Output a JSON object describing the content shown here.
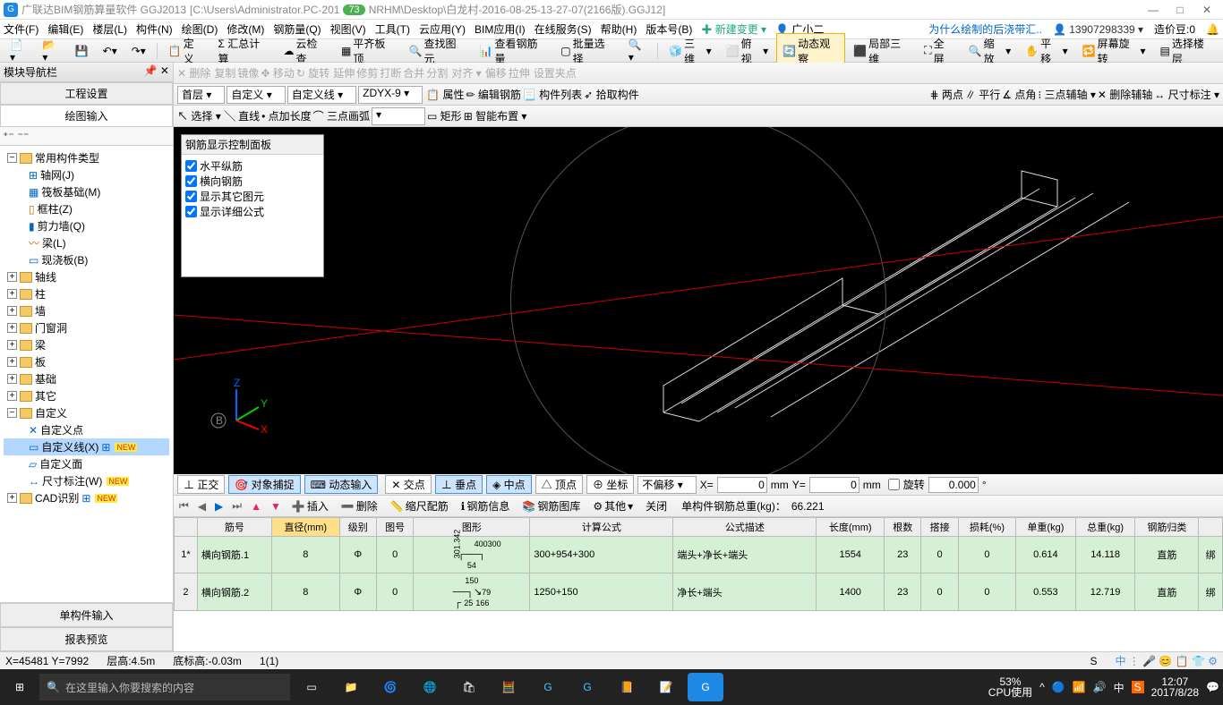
{
  "titlebar": {
    "app_name": "广联达BIM钢筋算量软件 GGJ2013",
    "file_path": "[C:\\Users\\Administrator.PC-201",
    "badge": "73",
    "file_rest": "NRHM\\Desktop\\白龙村-2016-08-25-13-27-07(2166版).GGJ12]"
  },
  "menubar": {
    "items": [
      "文件(F)",
      "编辑(E)",
      "楼层(L)",
      "构件(N)",
      "绘图(D)",
      "修改(M)",
      "钢筋量(Q)",
      "视图(V)",
      "工具(T)",
      "云应用(Y)",
      "BIM应用(I)",
      "在线服务(S)",
      "帮助(H)",
      "版本号(B)"
    ],
    "new_change": "新建变更",
    "user": "广小二",
    "promo": "为什么绘制的后浇带汇..",
    "phone": "13907298339",
    "credit_label": "造价豆:0"
  },
  "toolbar1": {
    "define": "定义",
    "sum_calc": "Σ 汇总计算",
    "cloud_check": "云检查",
    "level_top": "平齐板顶",
    "find_ent": "查找图元",
    "view_rebar": "查看钢筋量",
    "batch_sel": "批量选择",
    "view3d": "三维",
    "elev": "俯视",
    "dyn_obs": "动态观察",
    "part3d": "局部三维",
    "fullscreen": "全屏",
    "zoom": "缩放",
    "pan": "平移",
    "screen_rot": "屏幕旋转",
    "sel_floor": "选择楼层"
  },
  "side": {
    "title": "模块导航栏",
    "tab1": "工程设置",
    "tab2": "绘图输入",
    "nodes": {
      "common": "常用构件类型",
      "grid": "轴网(J)",
      "raft": "筏板基础(M)",
      "col": "框柱(Z)",
      "wall": "剪力墙(Q)",
      "beam": "梁(L)",
      "slab": "现浇板(B)",
      "axis": "轴线",
      "pillar": "柱",
      "wallc": "墙",
      "opening": "门窗洞",
      "beamc": "梁",
      "slabc": "板",
      "found": "基础",
      "other": "其它",
      "custom": "自定义",
      "cpoint": "自定义点",
      "cline": "自定义线(X)",
      "cface": "自定义面",
      "dim": "尺寸标注(W)",
      "cad": "CAD识别"
    },
    "btab1": "单构件输入",
    "btab2": "报表预览"
  },
  "toolbar_edit": {
    "delete": "删除",
    "copy": "复制",
    "mirror": "镜像",
    "move": "移动",
    "rotate": "旋转",
    "extend": "延伸",
    "trim": "修剪",
    "break": "打断",
    "merge": "合并",
    "split": "分割",
    "align": "对齐",
    "offset": "偏移",
    "stretch": "拉伸",
    "set_grip": "设置夹点"
  },
  "toolbar_ctx": {
    "floor": "首层",
    "custom": "自定义",
    "cline": "自定义线",
    "code": "ZDYX-9",
    "attr": "属性",
    "edit_rebar": "编辑钢筋",
    "comp_list": "构件列表",
    "pick": "拾取构件",
    "two_pt": "两点",
    "parallel": "平行",
    "angle": "点角",
    "three_aux": "三点辅轴",
    "del_aux": "删除辅轴",
    "dim_mark": "尺寸标注"
  },
  "toolbar_draw": {
    "select": "选择",
    "line": "直线",
    "add_len": "点加长度",
    "arc3": "三点画弧",
    "rect": "矩形",
    "smart": "智能布置"
  },
  "float": {
    "title": "钢筋显示控制面板",
    "chk1": "水平纵筋",
    "chk2": "横向钢筋",
    "chk3": "显示其它图元",
    "chk4": "显示详细公式"
  },
  "snap": {
    "ortho": "正交",
    "obj_snap": "对象捕捉",
    "dyn_input": "动态输入",
    "inter": "交点",
    "perp": "垂点",
    "mid": "中点",
    "vertex": "顶点",
    "grd": "坐标",
    "no_off": "不偏移",
    "x_lbl": "X=",
    "x_val": "0",
    "mm": "mm",
    "y_lbl": "Y=",
    "y_val": "0",
    "rotate": "旋转",
    "rot_val": "0.000"
  },
  "databar": {
    "insert": "插入",
    "delete": "删除",
    "scale": "缩尺配筋",
    "info": "钢筋信息",
    "lib": "钢筋图库",
    "other": "其他",
    "close": "关闭",
    "total_label": "单构件钢筋总重(kg)：",
    "total_val": "66.221"
  },
  "grid": {
    "headers": [
      "",
      "筋号",
      "直径(mm)",
      "级别",
      "图号",
      "图形",
      "计算公式",
      "公式描述",
      "长度(mm)",
      "根数",
      "搭接",
      "损耗(%)",
      "单重(kg)",
      "总重(kg)",
      "钢筋归类",
      ""
    ],
    "rows": [
      {
        "n": "1*",
        "name": "横向钢筋.1",
        "dia": "8",
        "lvl": "Φ",
        "fig": "0",
        "shape_t": "400300",
        "shape_b": "54",
        "shape_l": "301.342",
        "formula": "300+954+300",
        "desc": "端头+净长+端头",
        "len": "1554",
        "cnt": "23",
        "lap": "0",
        "loss": "0",
        "uw": "0.614",
        "tw": "14.118",
        "cls": "直筋",
        "x": "绑"
      },
      {
        "n": "2",
        "name": "横向钢筋.2",
        "dia": "8",
        "lvl": "Φ",
        "fig": "0",
        "shape_t": "150",
        "shape_b": "79",
        "shape_l": "25",
        "shape_l2": "166",
        "formula": "1250+150",
        "desc": "净长+端头",
        "len": "1400",
        "cnt": "23",
        "lap": "0",
        "loss": "0",
        "uw": "0.553",
        "tw": "12.719",
        "cls": "直筋",
        "x": "绑"
      }
    ]
  },
  "status": {
    "coord": "X=45481 Y=7992",
    "floor_h": "层高:4.5m",
    "base": "底标高:-0.03m",
    "sel": "1(1)",
    "cpu": "CPU使用"
  },
  "taskbar": {
    "search_ph": "在这里输入你要搜索的内容",
    "battery": "53%",
    "time": "12:07",
    "date": "2017/8/28"
  }
}
